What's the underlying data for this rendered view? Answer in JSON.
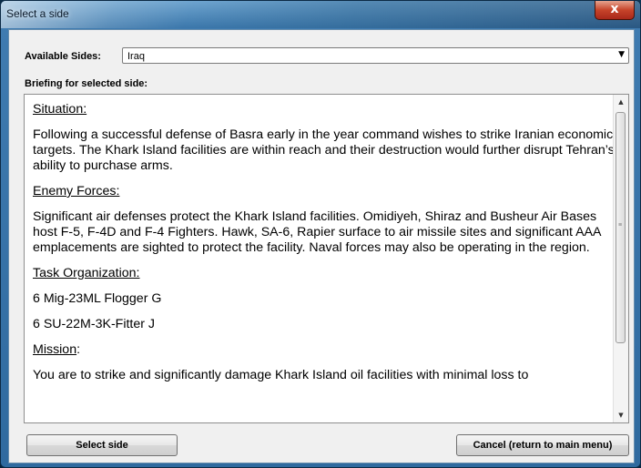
{
  "window": {
    "title": "Select a side",
    "close_label": "x"
  },
  "sides": {
    "label": "Available Sides:",
    "selected": "Iraq"
  },
  "briefing": {
    "label": "Briefing for selected side:",
    "situation_heading": "Situation:",
    "situation_text": "Following a successful defense of Basra early in the year command wishes to strike Iranian economic targets.  The Khark Island facilities are within reach and their destruction would further disrupt Tehran’s ability to purchase arms.",
    "enemy_heading": "Enemy Forces:",
    "enemy_text": "Significant air defenses protect the Khark Island facilities. Omidiyeh, Shiraz and Busheur Air Bases host F-5, F-4D and F-4 Fighters. Hawk, SA-6, Rapier surface to air missile sites and significant AAA emplacements are sighted to protect the facility. Naval forces may also be operating in the region.",
    "task_heading": "Task Organization:",
    "task_items": [
      "6 Mig-23ML Flogger G",
      "6 SU-22M-3K-Fitter J"
    ],
    "mission_heading": "Mission",
    "mission_heading_suffix": ":",
    "mission_text": "You are to strike and significantly damage Khark Island oil facilities with minimal loss to"
  },
  "buttons": {
    "select": "Select side",
    "cancel": "Cancel (return to main menu)"
  }
}
